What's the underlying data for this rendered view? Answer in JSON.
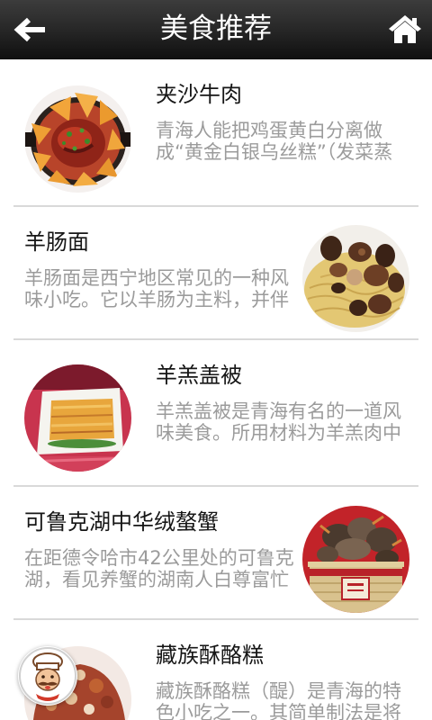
{
  "header": {
    "title": "美食推荐",
    "back_icon": "back-arrow-icon",
    "home_icon": "home-icon"
  },
  "foods": [
    {
      "title": "夹沙牛肉",
      "desc_lines": [
        "青海人能把鸡蛋黄白分离做",
        "成“黄金白银乌丝糕”（发菜蒸"
      ]
    },
    {
      "title": "羊肠面",
      "desc_lines": [
        "羊肠面是西宁地区常见的一种风",
        "味小吃。它以羊肠为主料，并伴"
      ]
    },
    {
      "title": "羊羔盖被",
      "desc_lines": [
        "羊羔盖被是青海有名的一道风",
        "味美食。所用材料为羊羔肉中"
      ]
    },
    {
      "title": "可鲁克湖中华绒螯蟹",
      "desc_lines": [
        "在距德令哈市42公里处的可鲁克",
        "湖，看见养蟹的湖南人白尊富忙"
      ]
    },
    {
      "title": "藏族酥酪糕",
      "desc_lines": [
        "藏族酥酪糕（醍）是青海的特",
        "色小吃之一。其简单制法是将"
      ]
    }
  ],
  "floating_button": {
    "icon": "chef-avatar-icon"
  },
  "colors": {
    "header_top": "#3c3c3c",
    "header_bottom": "#0f0f0f",
    "header_text": "#ffffff",
    "title_text": "#161616",
    "desc_text": "#9b9b9b",
    "divider": "#d9d9d9",
    "background": "#ffffff"
  }
}
